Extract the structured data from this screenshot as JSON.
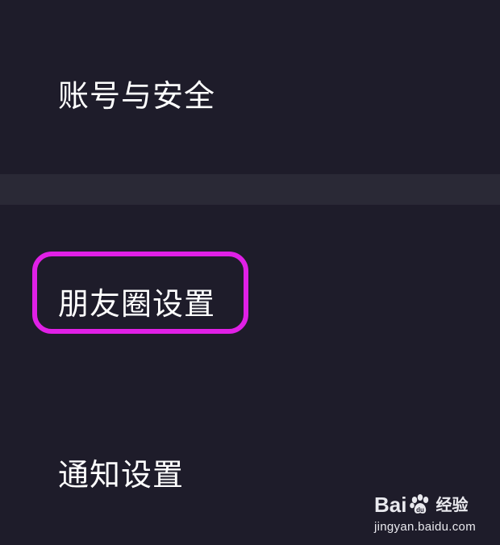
{
  "settings": {
    "items": [
      {
        "label": "账号与安全"
      },
      {
        "label": "朋友圈设置",
        "highlighted": true
      },
      {
        "label": "通知设置"
      }
    ]
  },
  "theme": {
    "background": "#1e1c2a",
    "divider": "#2a2936",
    "highlight": "#e020e6",
    "text": "#ffffff"
  },
  "watermark": {
    "brand_left": "Bai",
    "icon": "paw-icon",
    "brand_right": "经验",
    "url": "jingyan.baidu.com"
  }
}
